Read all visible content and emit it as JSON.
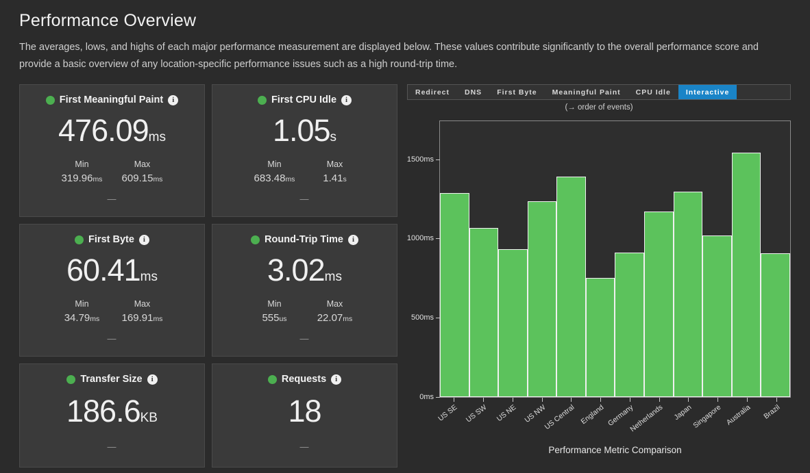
{
  "header": {
    "title": "Performance Overview",
    "description": "The averages, lows, and highs of each major performance measurement are displayed below. These values contribute significantly to the overall performance score and provide a basic overview of any location-specific performance issues such as a high round-trip time."
  },
  "status_color": "#4caf50",
  "accent_color": "#1a84c7",
  "bar_color": "#5cc25c",
  "labels": {
    "min": "Min",
    "max": "Max",
    "placeholder_dash": "—",
    "info_glyph": "i"
  },
  "cards": [
    {
      "title": "First Meaningful Paint",
      "value": "476.09",
      "unit": "ms",
      "min_label": "Min",
      "min_value": "319.96",
      "min_unit": "ms",
      "max_label": "Max",
      "max_value": "609.15",
      "max_unit": "ms",
      "footer": "—"
    },
    {
      "title": "First CPU Idle",
      "value": "1.05",
      "unit": "s",
      "min_label": "Min",
      "min_value": "683.48",
      "min_unit": "ms",
      "max_label": "Max",
      "max_value": "1.41",
      "max_unit": "s",
      "footer": "—"
    },
    {
      "title": "First Byte",
      "value": "60.41",
      "unit": "ms",
      "min_label": "Min",
      "min_value": "34.79",
      "min_unit": "ms",
      "max_label": "Max",
      "max_value": "169.91",
      "max_unit": "ms",
      "footer": "—"
    },
    {
      "title": "Round-Trip Time",
      "value": "3.02",
      "unit": "ms",
      "min_label": "Min",
      "min_value": "555",
      "min_unit": "us",
      "max_label": "Max",
      "max_value": "22.07",
      "max_unit": "ms",
      "footer": "—"
    },
    {
      "title": "Transfer Size",
      "value": "186.6",
      "unit": "KB",
      "footer": "—"
    },
    {
      "title": "Requests",
      "value": "18",
      "unit": "",
      "footer": "—"
    }
  ],
  "chart_tabs": {
    "items": [
      {
        "label": "Redirect",
        "active": false
      },
      {
        "label": "DNS",
        "active": false
      },
      {
        "label": "First Byte",
        "active": false
      },
      {
        "label": "Meaningful Paint",
        "active": false
      },
      {
        "label": "CPU Idle",
        "active": false
      },
      {
        "label": "Interactive",
        "active": true
      }
    ],
    "subtitle": "(→ order of events)"
  },
  "chart_data": {
    "type": "bar",
    "title": "",
    "xlabel": "Performance Metric Comparison",
    "ylabel": "",
    "categories": [
      "US SE",
      "US SW",
      "US NE",
      "US NW",
      "US Central",
      "England",
      "Germany",
      "Netherlands",
      "Japan",
      "Singapore",
      "Australia",
      "Brazil"
    ],
    "values": [
      1288,
      1068,
      932,
      1236,
      1392,
      752,
      912,
      1172,
      1296,
      1020,
      1540,
      908
    ],
    "unit": "ms",
    "ylim": [
      0,
      1740
    ],
    "yticks": [
      0,
      500,
      1000,
      1500
    ],
    "ytick_labels": [
      "0ms",
      "500ms",
      "1000ms",
      "1500ms"
    ],
    "grid": false,
    "legend": false,
    "series_color": "#5cc25c"
  }
}
